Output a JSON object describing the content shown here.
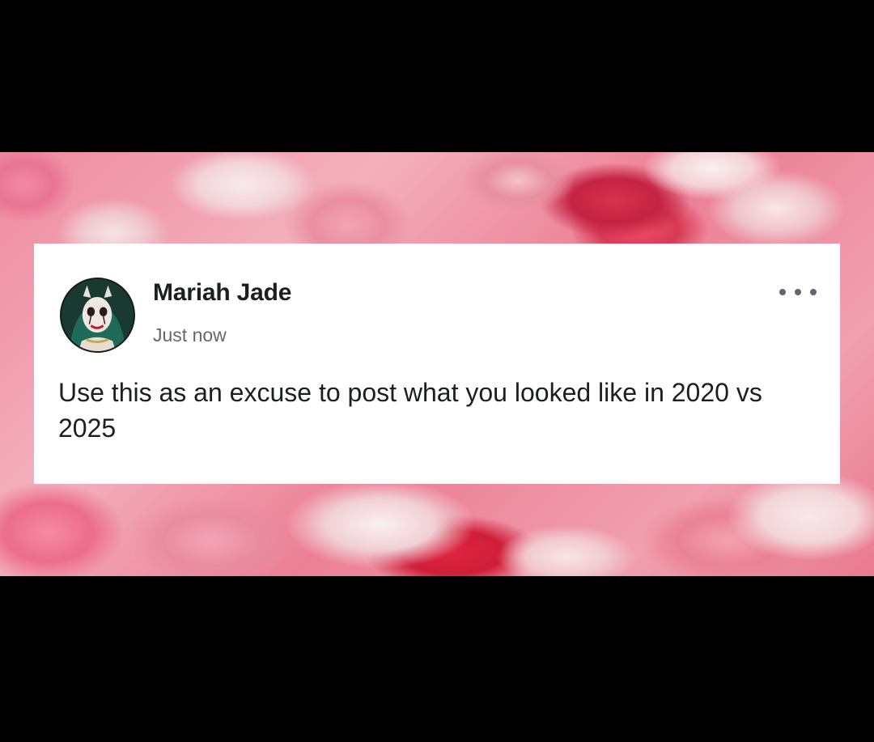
{
  "post": {
    "author": "Mariah Jade",
    "timestamp": "Just now",
    "body": "Use this as an excuse to post what you looked like in 2020 vs 2025"
  },
  "icons": {
    "more": "more-options-icon",
    "avatar": "profile-avatar"
  },
  "colors": {
    "background": "#000000",
    "card": "#ffffff",
    "text": "#1c1e21",
    "secondary_text": "#65676b",
    "backdrop_accent": "#ec7f95"
  }
}
